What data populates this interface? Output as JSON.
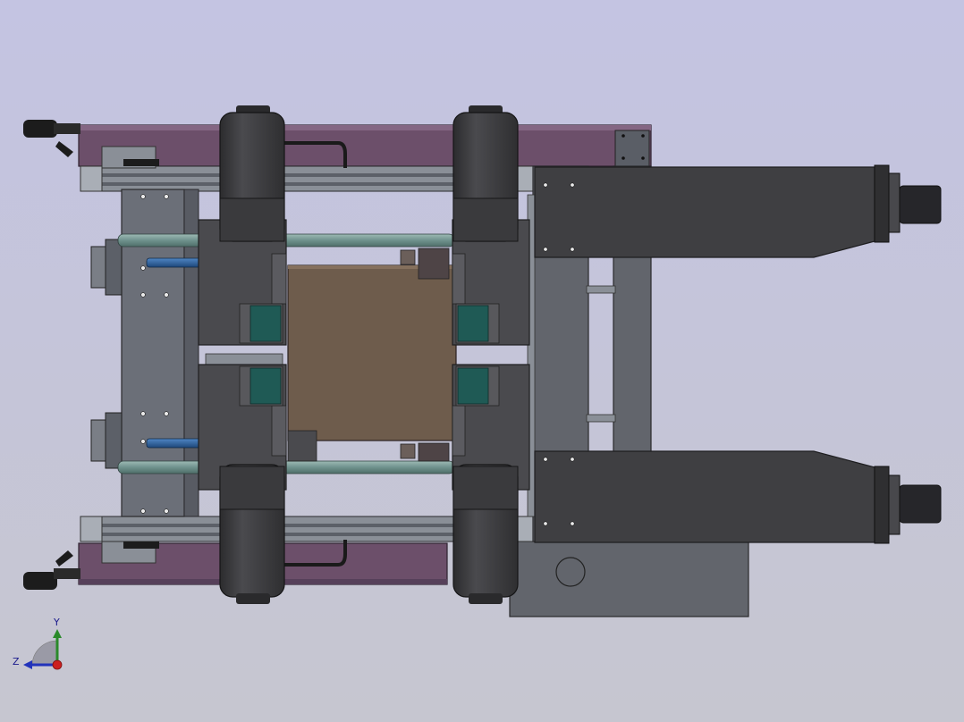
{
  "viewport": {
    "background_top": "#c4c4e2",
    "background_bottom": "#c6c6d0"
  },
  "colors": {
    "frame_purple": "#6c4f6a",
    "frame_purple_dark": "#4e3a4d",
    "dark_body": "#3f3f42",
    "dark_body_edge": "#2a2a2c",
    "steel_gray": "#6b6f78",
    "steel_light": "#9aa0aa",
    "rail_gray": "#8a8f97",
    "rod_teal": "#7fa39e",
    "cylinder_blue": "#2d5f9a",
    "motor_teal": "#1f5a55",
    "plate_brown": "#6e5c4c",
    "highlight": "#c8ccd4",
    "black_handle": "#1c1c1c"
  },
  "triad": {
    "y_label": "Y",
    "z_label": "Z",
    "y_color": "#2a8a2a",
    "z_color": "#2233bb",
    "x_color": "#cc1f1f"
  }
}
